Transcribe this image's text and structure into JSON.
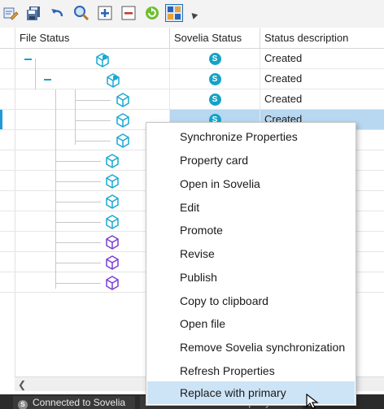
{
  "toolbar": {
    "buttons": [
      {
        "icon": "pencil-edit-icon"
      },
      {
        "icon": "save-all-icon"
      },
      {
        "icon": "redo-arrow-icon"
      },
      {
        "icon": "magnifier-icon"
      },
      {
        "icon": "expand-plus-icon"
      },
      {
        "icon": "collapse-minus-icon"
      },
      {
        "icon": "refresh-icon"
      },
      {
        "icon": "structure-view-icon",
        "active": true
      }
    ]
  },
  "grid": {
    "columns": [
      "File Status",
      "Sovelia Status",
      "Status description"
    ],
    "rows": [
      {
        "badge": "S",
        "desc": "Created"
      },
      {
        "badge": "S",
        "desc": "Created"
      },
      {
        "badge": "S",
        "desc": "Created"
      },
      {
        "badge": "S",
        "desc": "Created",
        "selected": true
      },
      {
        "badge": "",
        "desc": ""
      },
      {
        "badge": "",
        "desc": ""
      },
      {
        "badge": "",
        "desc": ""
      },
      {
        "badge": "",
        "desc": ""
      },
      {
        "badge": "",
        "desc": ""
      },
      {
        "badge": "",
        "desc": ""
      },
      {
        "badge": "",
        "desc": ""
      },
      {
        "badge": "",
        "desc": ""
      }
    ]
  },
  "context_menu": {
    "items": [
      "Synchronize Properties",
      "Property card",
      "Open in Sovelia",
      "Edit",
      "Promote",
      "Revise",
      "Publish",
      "Copy to clipboard",
      "Open file",
      "Remove Sovelia synchronization",
      "Refresh Properties",
      "Replace with primary"
    ],
    "hovered_item": "Replace with primary"
  },
  "statusbar": {
    "connection_icon_letter": "S",
    "connection_label": "Connected to Sovelia",
    "addin_label": "Sovelia CAD Add-in Property C..."
  },
  "colors": {
    "accent_blue": "#1f9bd6",
    "selection": "#b8d7f0",
    "cube_cyan": "#19a9d3",
    "cube_purple": "#7b3fd1",
    "menu_hover": "#cde4f7"
  }
}
